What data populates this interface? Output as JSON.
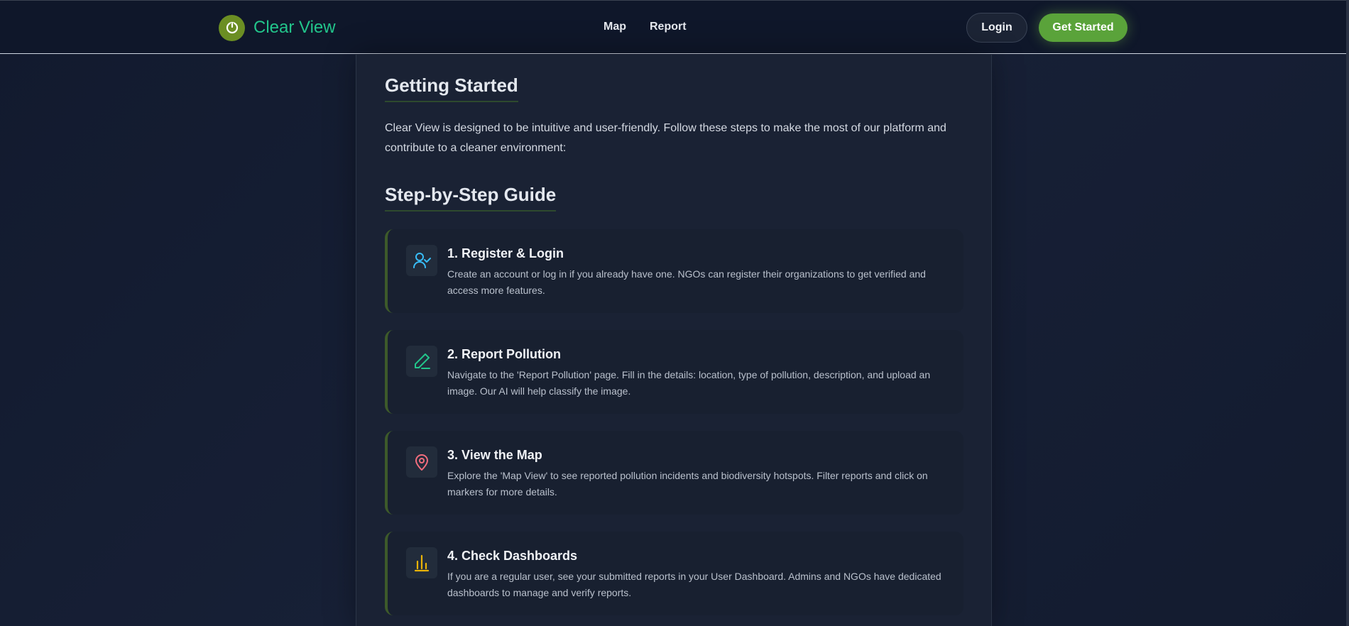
{
  "app": {
    "name": "Clear View",
    "accent_color": "#22c58b",
    "logo_color": "#6b8e23"
  },
  "nav": {
    "links": [
      "Map",
      "Report"
    ],
    "login_label": "Login",
    "get_started_label": "Get Started"
  },
  "main": {
    "heading": "Getting Started",
    "intro": "Clear View is designed to be intuitive and user-friendly. Follow these steps to make the most of our platform and contribute to a cleaner environment:",
    "guide_heading": "Step-by-Step Guide",
    "steps": [
      {
        "title": "1. Register & Login",
        "description": "Create an account or log in if you already have one. NGOs can register their organizations to get verified and access more features.",
        "icon": "user-check-icon",
        "icon_color": "#38bdf8"
      },
      {
        "title": "2. Report Pollution",
        "description": "Navigate to the 'Report Pollution' page. Fill in the details: location, type of pollution, description, and upload an image. Our AI will help classify the image.",
        "icon": "pencil-icon",
        "icon_color": "#22c58b"
      },
      {
        "title": "3. View the Map",
        "description": "Explore the 'Map View' to see reported pollution incidents and biodiversity hotspots. Filter reports and click on markers for more details.",
        "icon": "map-pin-icon",
        "icon_color": "#f26d7d"
      },
      {
        "title": "4. Check Dashboards",
        "description": "If you are a regular user, see your submitted reports in your User Dashboard. Admins and NGOs have dedicated dashboards to manage and verify reports.",
        "icon": "bar-chart-icon",
        "icon_color": "#eab308"
      }
    ]
  }
}
